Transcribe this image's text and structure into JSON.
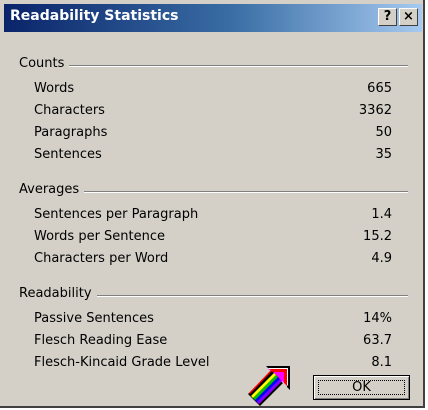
{
  "window": {
    "title": "Readability Statistics",
    "help_label": "?",
    "close_label": "×"
  },
  "counts": {
    "title": "Counts",
    "rows": [
      {
        "label": "Words",
        "value": "665"
      },
      {
        "label": "Characters",
        "value": "3362"
      },
      {
        "label": "Paragraphs",
        "value": "50"
      },
      {
        "label": "Sentences",
        "value": "35"
      }
    ]
  },
  "averages": {
    "title": "Averages",
    "rows": [
      {
        "label": "Sentences per Paragraph",
        "value": "1.4"
      },
      {
        "label": "Words per Sentence",
        "value": "15.2"
      },
      {
        "label": "Characters per Word",
        "value": "4.9"
      }
    ]
  },
  "readability": {
    "title": "Readability",
    "rows": [
      {
        "label": "Passive Sentences",
        "value": "14%"
      },
      {
        "label": "Flesch Reading Ease",
        "value": "63.7"
      },
      {
        "label": "Flesch-Kincaid Grade Level",
        "value": "8.1"
      }
    ]
  },
  "buttons": {
    "ok_label": "OK"
  },
  "icons": {
    "logo": "rainbow-arrow-icon"
  },
  "colors": {
    "titlebar_start": "#0a246a",
    "titlebar_end": "#a6caf0",
    "dialog_bg": "#d4d0c8"
  }
}
